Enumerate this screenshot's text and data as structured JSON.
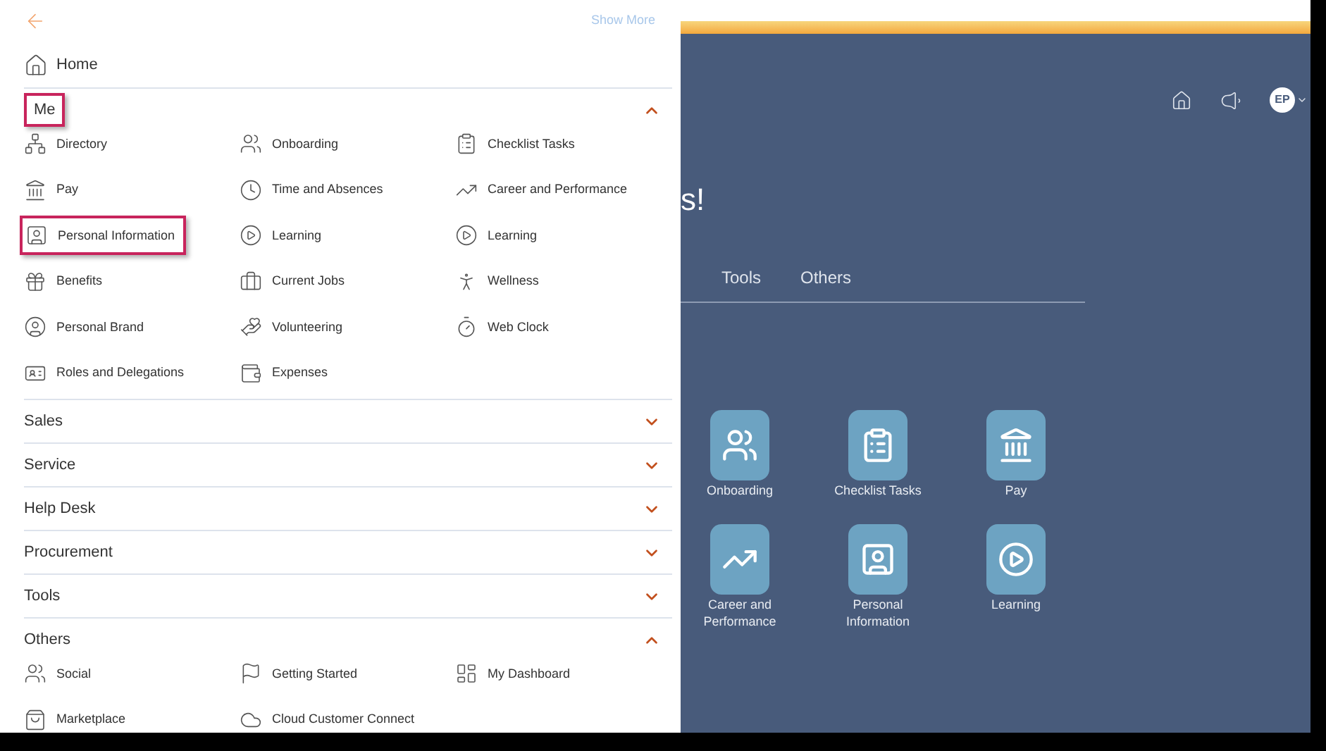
{
  "menu": {
    "show_more": "Show More",
    "home": "Home",
    "sections": [
      {
        "title": "Me",
        "expanded": true,
        "highlighted": true,
        "items": [
          {
            "label": "Directory",
            "highlighted": false
          },
          {
            "label": "Onboarding",
            "highlighted": false
          },
          {
            "label": "Checklist Tasks",
            "highlighted": false
          },
          {
            "label": "Pay",
            "highlighted": false
          },
          {
            "label": "Time and Absences",
            "highlighted": false
          },
          {
            "label": "Career and Performance",
            "highlighted": false
          },
          {
            "label": "Personal Information",
            "highlighted": true
          },
          {
            "label": "Learning",
            "highlighted": false
          },
          {
            "label": "Learning",
            "highlighted": false
          },
          {
            "label": "Benefits",
            "highlighted": false
          },
          {
            "label": "Current Jobs",
            "highlighted": false
          },
          {
            "label": "Wellness",
            "highlighted": false
          },
          {
            "label": "Personal Brand",
            "highlighted": false
          },
          {
            "label": "Volunteering",
            "highlighted": false
          },
          {
            "label": "Web Clock",
            "highlighted": false
          },
          {
            "label": "Roles and Delegations",
            "highlighted": false
          },
          {
            "label": "Expenses",
            "highlighted": false
          }
        ]
      },
      {
        "title": "Sales",
        "expanded": false,
        "highlighted": false
      },
      {
        "title": "Service",
        "expanded": false,
        "highlighted": false
      },
      {
        "title": "Help Desk",
        "expanded": false,
        "highlighted": false
      },
      {
        "title": "Procurement",
        "expanded": false,
        "highlighted": false
      },
      {
        "title": "Tools",
        "expanded": false,
        "highlighted": false
      },
      {
        "title": "Others",
        "expanded": true,
        "highlighted": false,
        "items": [
          {
            "label": "Social",
            "highlighted": false
          },
          {
            "label": "Getting Started",
            "highlighted": false
          },
          {
            "label": "My Dashboard",
            "highlighted": false
          },
          {
            "label": "Marketplace",
            "highlighted": false
          },
          {
            "label": "Cloud Customer Connect",
            "highlighted": false
          }
        ]
      }
    ]
  },
  "header": {
    "avatar": "EP"
  },
  "welcome_fragment": "s!",
  "tabs": [
    {
      "label": "Tools"
    },
    {
      "label": "Others"
    }
  ],
  "tiles": [
    {
      "label": "Onboarding"
    },
    {
      "label": "Checklist Tasks"
    },
    {
      "label": "Pay"
    },
    {
      "label": "Career and Performance"
    },
    {
      "label": "Personal Information"
    },
    {
      "label": "Learning"
    }
  ]
}
